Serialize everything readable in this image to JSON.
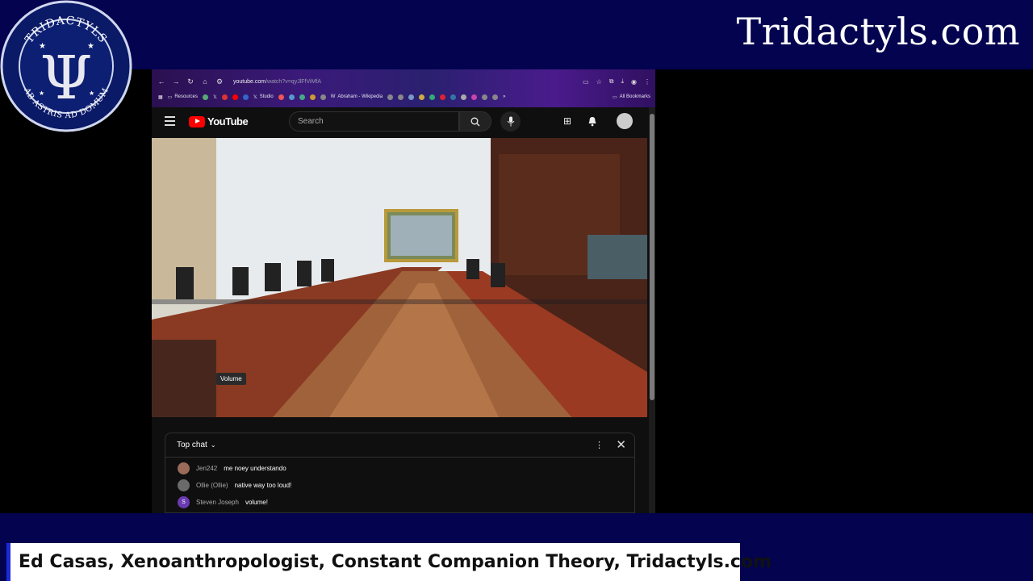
{
  "brand": {
    "title": "Tridactyls.com"
  },
  "logo": {
    "top_text": "TRIDACTYLS",
    "bottom_text": "AB ASTRIS AD DOMUM",
    "symbol": "Ψ"
  },
  "lower_third": {
    "text": "Ed Casas, Xenoanthropologist, Constant Companion Theory, Tridactyls.com"
  },
  "browser": {
    "url_domain": "youtube.com",
    "url_path": "/watch?v=qyJlFfViMfA",
    "bookmarks": [
      {
        "label": "Resources",
        "icon": "folder-icon"
      },
      {
        "label": "Studio",
        "icon": "x-icon"
      },
      {
        "label": "Abraham - Wikipedia",
        "icon": "wikipedia-icon"
      }
    ],
    "all_bookmarks": "All Bookmarks"
  },
  "youtube": {
    "logo_text": "YouTube",
    "search_placeholder": "Search",
    "volume_tooltip": "Volume"
  },
  "chat": {
    "title": "Top chat",
    "messages": [
      {
        "author": "Jen242",
        "text": "me noey understando",
        "avatar": "",
        "color": "#9a6a5a"
      },
      {
        "author": "Ollie (Ollie)",
        "text": "native way too loud!",
        "avatar": "",
        "color": "#6a6a6a"
      },
      {
        "author": "Steven Joseph",
        "text": "volume!",
        "avatar": "S",
        "color": "#6a3ab0"
      }
    ]
  },
  "colors": {
    "band": "#03034f",
    "accent": "#1a2bd6",
    "youtube_red": "#ff0000"
  }
}
